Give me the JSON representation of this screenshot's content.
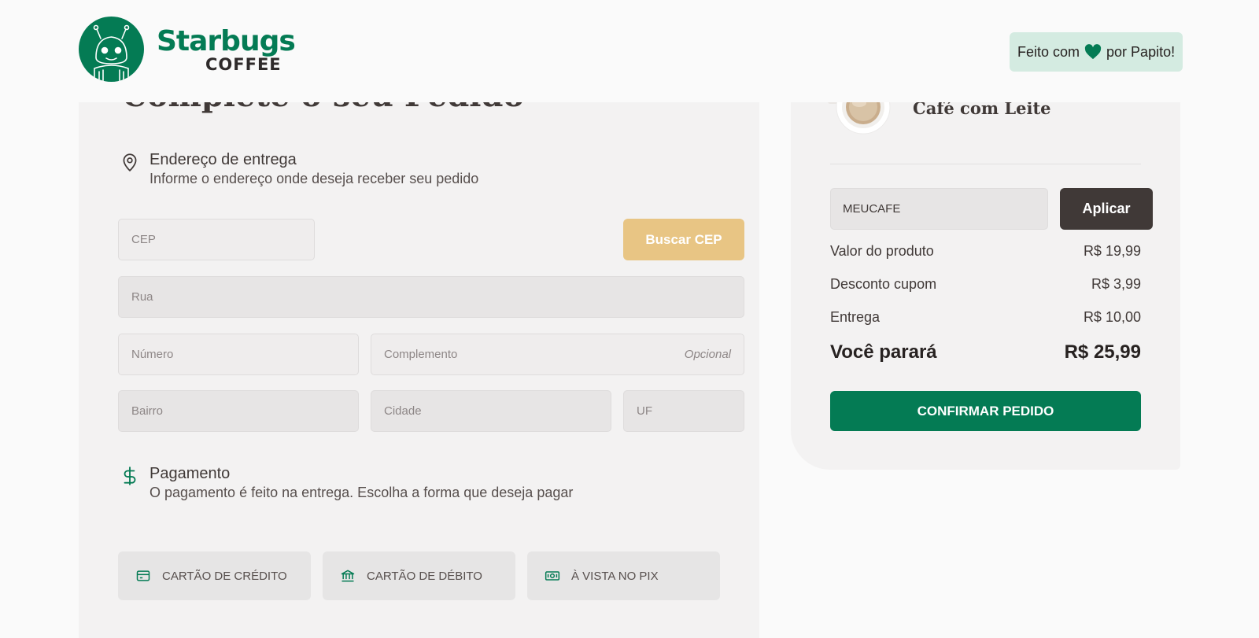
{
  "header": {
    "brand_name": "Starbugs",
    "brand_sub": "COFFEE",
    "credit_prefix": "Feito com",
    "credit_suffix": "por Papito!"
  },
  "form": {
    "title": "Complete o seu Pedido",
    "address": {
      "title": "Endereço de entrega",
      "subtitle": "Informe o endereço onde deseja receber seu pedido",
      "cep_placeholder": "CEP",
      "buscar_label": "Buscar CEP",
      "rua_placeholder": "Rua",
      "numero_placeholder": "Número",
      "complemento_placeholder": "Complemento",
      "complemento_hint": "Opcional",
      "bairro_placeholder": "Bairro",
      "cidade_placeholder": "Cidade",
      "uf_placeholder": "UF"
    },
    "payment": {
      "title": "Pagamento",
      "subtitle": "O pagamento é feito na entrega. Escolha a forma que deseja pagar",
      "options": [
        {
          "label": "CARTÃO DE CRÉDITO",
          "icon": "credit-card-icon"
        },
        {
          "label": "CARTÃO DE DÉBITO",
          "icon": "bank-icon"
        },
        {
          "label": "À VISTA NO PIX",
          "icon": "money-icon"
        }
      ]
    }
  },
  "summary": {
    "item_name": "Café com Leite",
    "coupon_value": "MEUCAFE",
    "apply_label": "Aplicar",
    "rows": [
      {
        "label": "Valor do produto",
        "value": "R$ 19,99"
      },
      {
        "label": "Desconto cupom",
        "value": "R$ 3,99"
      },
      {
        "label": "Entrega",
        "value": "R$ 10,00"
      }
    ],
    "total_label": "Você parará",
    "total_value": "R$ 25,99",
    "confirm_label": "CONFIRMAR PEDIDO"
  },
  "colors": {
    "brand_green": "#047b54",
    "accent_yellow": "#e8c584",
    "dark_brown": "#403937"
  }
}
